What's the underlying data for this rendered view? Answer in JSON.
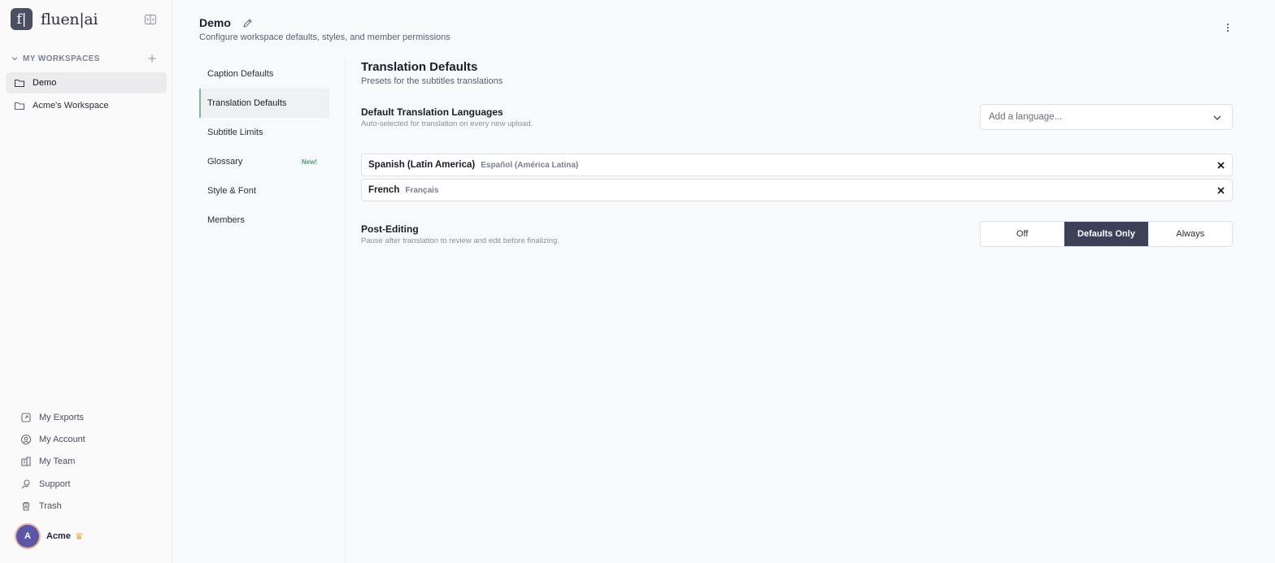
{
  "app": {
    "logo_letter": "f|",
    "logo_text": "fluen|ai"
  },
  "sidebar": {
    "section_label": "MY WORKSPACES",
    "workspaces": [
      {
        "label": "Demo",
        "active": true
      },
      {
        "label": "Acme's Workspace",
        "active": false
      }
    ],
    "bottom_items": [
      {
        "label": "My Exports",
        "icon": "exports-icon"
      },
      {
        "label": "My Account",
        "icon": "account-icon"
      },
      {
        "label": "My Team",
        "icon": "team-icon"
      },
      {
        "label": "Support",
        "icon": "support-icon"
      },
      {
        "label": "Trash",
        "icon": "trash-icon"
      }
    ],
    "user": {
      "initial": "A",
      "name": "Acme",
      "badge": "crown-icon"
    }
  },
  "header": {
    "title": "Demo",
    "subtitle": "Configure workspace defaults, styles, and member permissions"
  },
  "settings_nav": {
    "items": [
      {
        "label": "Caption Defaults",
        "active": false
      },
      {
        "label": "Translation Defaults",
        "active": true
      },
      {
        "label": "Subtitle Limits",
        "active": false
      },
      {
        "label": "Glossary",
        "active": false,
        "badge": "New!"
      },
      {
        "label": "Style & Font",
        "active": false
      },
      {
        "label": "Members",
        "active": false
      }
    ]
  },
  "content": {
    "title": "Translation Defaults",
    "subtitle": "Presets for the subtitles translations",
    "default_languages": {
      "title": "Default Translation Languages",
      "description": "Auto-selected for translation on every new upload.",
      "placeholder": "Add a language...",
      "selected": [
        {
          "name": "Spanish (Latin America)",
          "native": "Español (América Latina)"
        },
        {
          "name": "French",
          "native": "Français"
        }
      ]
    },
    "post_editing": {
      "title": "Post-Editing",
      "description": "Pause after translation to review and edit before finalizing.",
      "options": [
        "Off",
        "Defaults Only",
        "Always"
      ],
      "selected": "Defaults Only"
    }
  },
  "colors": {
    "accent": "#3c4059",
    "active_indicator": "#7fb79a",
    "new_badge": "#4f9e71",
    "avatar": "#5b57a6"
  }
}
